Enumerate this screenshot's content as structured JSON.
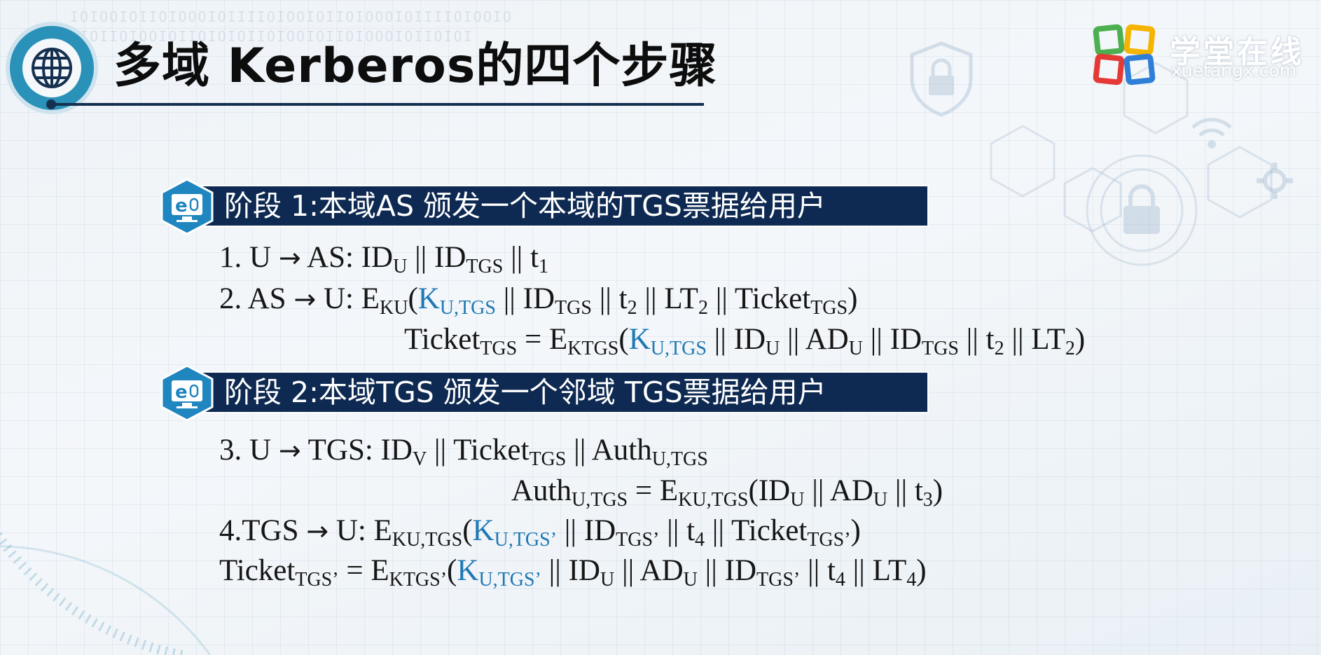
{
  "title": "多域 Kerberos的四个步骤",
  "logo": {
    "name": "学堂在线",
    "url": "xuetangx.com"
  },
  "icons": {
    "header": "globe-icon",
    "section": "e-learning-monitor-icon",
    "background": [
      "shield-lock-icon",
      "padlock-icon",
      "wifi-icon",
      "gear-icon"
    ]
  },
  "colors": {
    "banner": "#0e2a52",
    "badge": "#2a91b8",
    "key_highlight": "#1f78b4"
  },
  "stages": [
    {
      "label": "阶段 1:本域AS 颁发一个本域的TGS票据给用户"
    },
    {
      "label": "阶段 2:本域TGS 颁发一个邻域 TGS票据给用户"
    }
  ],
  "formulas": {
    "step1": {
      "prefix": "1. U ",
      "arrow": "→",
      "a": " AS: ID",
      "a_sub": "U",
      "b": " || ID",
      "b_sub": "TGS",
      "c": " || t",
      "c_sub": "1"
    },
    "step2": {
      "prefix": "2. AS ",
      "arrow": "→",
      "a": " U: E",
      "a_sub": "KU",
      "open": "(",
      "k": "K",
      "k_sub": "U,TGS",
      "b": " || ID",
      "b_sub": "TGS",
      "c": " || t",
      "c_sub": "2",
      "d": " || LT",
      "d_sub": "2",
      "e": " || Ticket",
      "e_sub": "TGS",
      "close": ")"
    },
    "ticket_tgs": {
      "a": "Ticket",
      "a_sub": "TGS",
      "b": " = E",
      "b_sub": "KTGS",
      "open": "(",
      "k": "K",
      "k_sub": "U,TGS",
      "c": " || ID",
      "c_sub": "U",
      "d": " || AD",
      "d_sub": "U",
      "e": " || ID",
      "e_sub": "TGS",
      "f": " || t",
      "f_sub": "2",
      "g": " || LT",
      "g_sub": "2",
      "close": ")"
    },
    "step3": {
      "prefix": "3. U ",
      "arrow": "→",
      "a": " TGS: ID",
      "a_sub": "V",
      "b": " || Ticket",
      "b_sub": "TGS",
      "c": " || Auth",
      "c_sub": "U,TGS"
    },
    "auth": {
      "a": "Auth",
      "a_sub": "U,TGS",
      "b": " =  E",
      "b_sub": "KU,TGS",
      "c": "(ID",
      "c_sub": "U",
      "d": " || AD",
      "d_sub": "U",
      "e": " || t",
      "e_sub": "3",
      "close": ")"
    },
    "step4": {
      "prefix": "4.TGS ",
      "arrow": "→",
      "a": " U: E",
      "a_sub": "KU,TGS",
      "open": "(",
      "k": "K",
      "k_sub": "U,TGS’",
      "b": " || ID",
      "b_sub": "TGS’",
      "c": " || t",
      "c_sub": "4",
      "d": " || Ticket",
      "d_sub": "TGS’",
      "close": ")"
    },
    "ticket_tgs2": {
      "a": "Ticket",
      "a_sub": "TGS’",
      "b": " = E",
      "b_sub": "KTGS’",
      "open": "(",
      "k": "K",
      "k_sub": "U,TGS’",
      "c": " || ID",
      "c_sub": "U",
      "d": " || AD",
      "d_sub": "U",
      "e": " || ID",
      "e_sub": "TGS’",
      "f": " || t",
      "f_sub": "4",
      "g": " || LT",
      "g_sub": "4",
      "close": ")"
    }
  }
}
